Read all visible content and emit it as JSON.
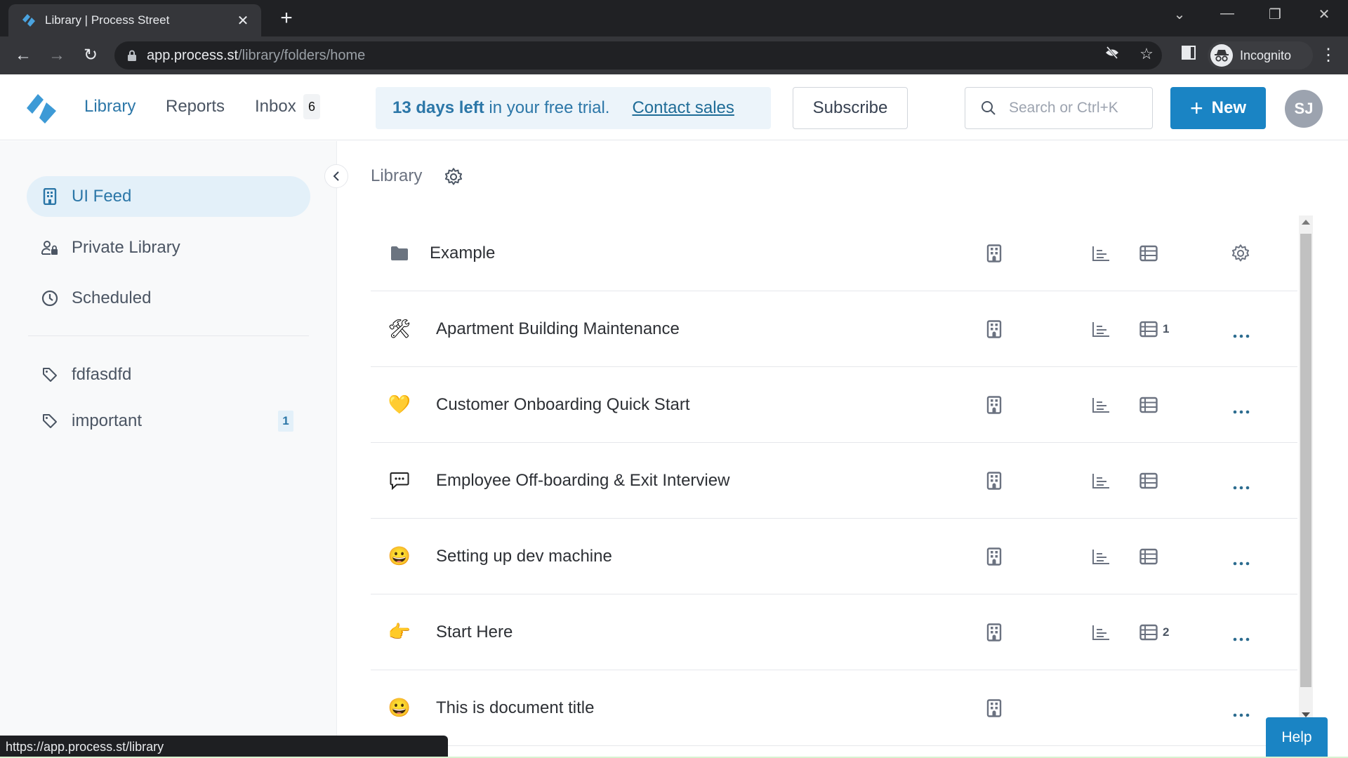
{
  "browser": {
    "tab_title": "Library | Process Street",
    "url_host": "app.process.st",
    "url_path": "/library/folders/home",
    "profile_label": "Incognito",
    "status_url": "https://app.process.st/library"
  },
  "header": {
    "nav": [
      {
        "label": "Library",
        "active": true
      },
      {
        "label": "Reports",
        "active": false
      },
      {
        "label": "Inbox",
        "active": false
      }
    ],
    "inbox_count": "6",
    "trial_bold": "13 days left",
    "trial_rest": " in your free trial.",
    "contact_label": "Contact sales",
    "subscribe_label": "Subscribe",
    "search_placeholder": "Search or Ctrl+K",
    "new_label": "New",
    "avatar_initials": "SJ"
  },
  "sidebar": {
    "items": [
      {
        "label": "UI Feed",
        "icon": "building-icon",
        "active": true
      },
      {
        "label": "Private Library",
        "icon": "user-lock-icon"
      },
      {
        "label": "Scheduled",
        "icon": "clock-icon"
      }
    ],
    "tags": [
      {
        "label": "fdfasdfd",
        "count": ""
      },
      {
        "label": "important",
        "count": "1"
      }
    ]
  },
  "content": {
    "breadcrumb": "Library",
    "rows": [
      {
        "type": "folder",
        "icon": "folder-icon",
        "glyph": "",
        "title": "Example",
        "table_count": ""
      },
      {
        "type": "workflow",
        "icon": "hammer-wrench-icon",
        "glyph": "🛠",
        "title": "Apartment Building Maintenance",
        "table_count": "1"
      },
      {
        "type": "workflow",
        "icon": "yellow-heart-icon",
        "glyph": "💛",
        "title": "Customer Onboarding Quick Start",
        "table_count": ""
      },
      {
        "type": "workflow",
        "icon": "speech-bubble-icon",
        "glyph": "",
        "title": "Employee Off-boarding & Exit Interview",
        "table_count": ""
      },
      {
        "type": "workflow",
        "icon": "grinning-face-icon",
        "glyph": "😀",
        "title": "Setting up dev machine",
        "table_count": ""
      },
      {
        "type": "workflow",
        "icon": "pointing-hand-icon",
        "glyph": "👉",
        "title": "Start Here",
        "table_count": "2"
      },
      {
        "type": "page",
        "icon": "grinning-face-icon",
        "glyph": "😀",
        "title": "This is document title",
        "table_count": ""
      }
    ]
  },
  "help_label": "Help",
  "colors": {
    "accent": "#1a84c4",
    "link": "#2c77a8",
    "trial_bg": "#ecf4fa",
    "sidebar_bg": "#f8f9fa"
  }
}
